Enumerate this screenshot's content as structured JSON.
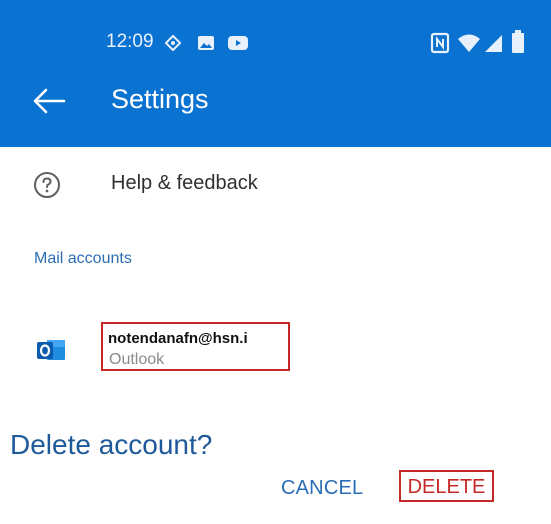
{
  "status_bar": {
    "time": "12:09",
    "left_icons": [
      "diamond-icon",
      "gallery-icon",
      "youtube-icon"
    ],
    "right_icons": [
      "nfc-icon",
      "wifi-icon",
      "signal-icon",
      "battery-icon"
    ]
  },
  "header": {
    "back_icon": "arrow-left-icon",
    "title": "Settings",
    "color": "#0a72d1"
  },
  "help": {
    "icon": "help-circle-icon",
    "label": "Help & feedback"
  },
  "mail_accounts": {
    "section_title": "Mail accounts",
    "accounts": [
      {
        "icon": "outlook-icon",
        "email": "notendanafn@hsn.i",
        "type": "Outlook"
      }
    ]
  },
  "dialog": {
    "title": "Delete account?",
    "cancel_label": "CANCEL",
    "delete_label": "DELETE",
    "accent_color": "#c62828"
  }
}
